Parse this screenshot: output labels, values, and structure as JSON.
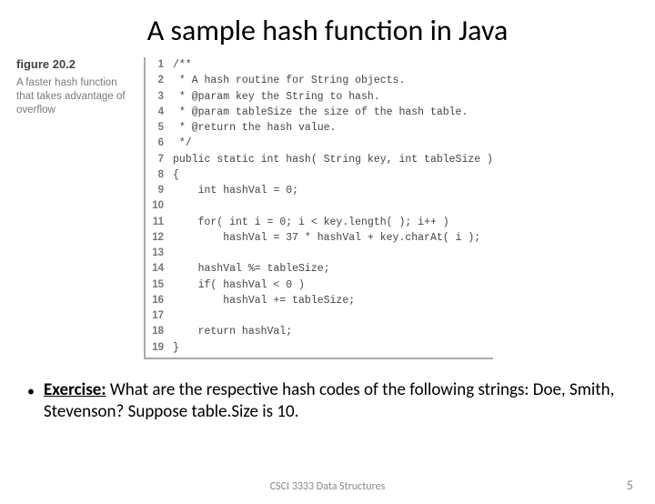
{
  "slide": {
    "title": "A sample hash function in Java",
    "footer_center": "CSCI 3333 Data Structures",
    "page_number": "5"
  },
  "figure": {
    "label": "figure 20.2",
    "caption": "A faster hash function that takes advantage of overflow"
  },
  "code": {
    "lines": [
      {
        "n": "1",
        "t": "/**"
      },
      {
        "n": "2",
        "t": " * A hash routine for String objects."
      },
      {
        "n": "3",
        "t": " * @param key the String to hash."
      },
      {
        "n": "4",
        "t": " * @param tableSize the size of the hash table."
      },
      {
        "n": "5",
        "t": " * @return the hash value."
      },
      {
        "n": "6",
        "t": " */"
      },
      {
        "n": "7",
        "t": "public static int hash( String key, int tableSize )"
      },
      {
        "n": "8",
        "t": "{"
      },
      {
        "n": "9",
        "t": "    int hashVal = 0;"
      },
      {
        "n": "10",
        "t": ""
      },
      {
        "n": "11",
        "t": "    for( int i = 0; i < key.length( ); i++ )"
      },
      {
        "n": "12",
        "t": "        hashVal = 37 * hashVal + key.charAt( i );"
      },
      {
        "n": "13",
        "t": ""
      },
      {
        "n": "14",
        "t": "    hashVal %= tableSize;"
      },
      {
        "n": "15",
        "t": "    if( hashVal < 0 )"
      },
      {
        "n": "16",
        "t": "        hashVal += tableSize;"
      },
      {
        "n": "17",
        "t": ""
      },
      {
        "n": "18",
        "t": "    return hashVal;"
      },
      {
        "n": "19",
        "t": "}"
      }
    ]
  },
  "exercise": {
    "label": "Exercise:",
    "text": " What are the respective hash codes of the following strings: Doe, Smith, Stevenson? Suppose table.Size is 10."
  }
}
